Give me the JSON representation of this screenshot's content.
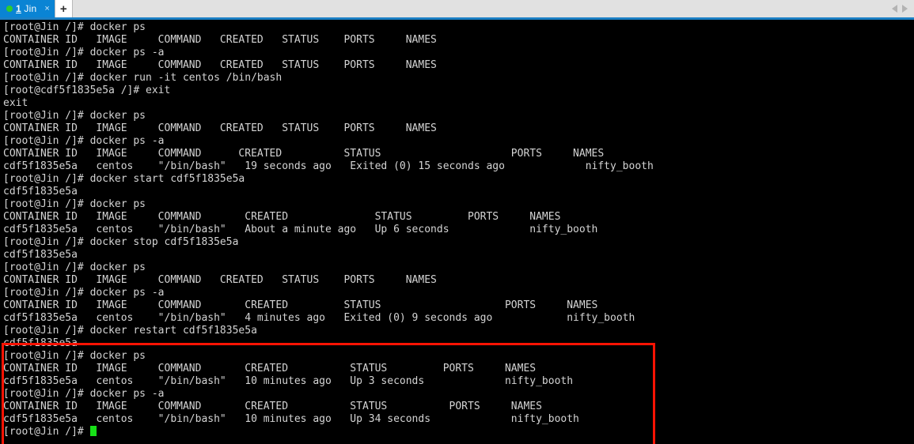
{
  "window": {
    "tab": {
      "status_dot": "green",
      "number": "1",
      "title": "Jin",
      "close_glyph": "×"
    },
    "new_tab_label": "+",
    "nav_prev_icon": "triangle-left-icon",
    "nav_next_icon": "triangle-right-icon",
    "accent_color": "#0a84d4",
    "underline_color": "#1b7fc4",
    "tabbar_bg": "#e1e1e1"
  },
  "terminal": {
    "bg_color": "#000000",
    "fg_color": "#d4d4d4",
    "cursor_color": "#17e017",
    "prompt_host": "[root@Jin /]#",
    "prompt_container": "[root@cdf5f1835e5a /]#",
    "lines": [
      "[root@Jin /]# docker ps",
      "CONTAINER ID   IMAGE     COMMAND   CREATED   STATUS    PORTS     NAMES",
      "[root@Jin /]# docker ps -a",
      "CONTAINER ID   IMAGE     COMMAND   CREATED   STATUS    PORTS     NAMES",
      "[root@Jin /]# docker run -it centos /bin/bash",
      "[root@cdf5f1835e5a /]# exit",
      "exit",
      "[root@Jin /]# docker ps",
      "CONTAINER ID   IMAGE     COMMAND   CREATED   STATUS    PORTS     NAMES",
      "[root@Jin /]# docker ps -a",
      "CONTAINER ID   IMAGE     COMMAND      CREATED          STATUS                     PORTS     NAMES",
      "cdf5f1835e5a   centos    \"/bin/bash\"   19 seconds ago   Exited (0) 15 seconds ago             nifty_booth",
      "[root@Jin /]# docker start cdf5f1835e5a",
      "cdf5f1835e5a",
      "[root@Jin /]# docker ps",
      "CONTAINER ID   IMAGE     COMMAND       CREATED              STATUS         PORTS     NAMES",
      "cdf5f1835e5a   centos    \"/bin/bash\"   About a minute ago   Up 6 seconds             nifty_booth",
      "[root@Jin /]# docker stop cdf5f1835e5a",
      "cdf5f1835e5a",
      "[root@Jin /]# docker ps",
      "CONTAINER ID   IMAGE     COMMAND   CREATED   STATUS    PORTS     NAMES",
      "[root@Jin /]# docker ps -a",
      "CONTAINER ID   IMAGE     COMMAND       CREATED         STATUS                    PORTS     NAMES",
      "cdf5f1835e5a   centos    \"/bin/bash\"   4 minutes ago   Exited (0) 9 seconds ago            nifty_booth",
      "[root@Jin /]# docker restart cdf5f1835e5a",
      "cdf5f1835e5a",
      "[root@Jin /]# docker ps",
      "CONTAINER ID   IMAGE     COMMAND       CREATED          STATUS         PORTS     NAMES",
      "cdf5f1835e5a   centos    \"/bin/bash\"   10 minutes ago   Up 3 seconds             nifty_booth",
      "[root@Jin /]# docker ps -a",
      "CONTAINER ID   IMAGE     COMMAND       CREATED          STATUS          PORTS     NAMES",
      "cdf5f1835e5a   centos    \"/bin/bash\"   10 minutes ago   Up 34 seconds             nifty_booth",
      "[root@Jin /]# "
    ]
  },
  "annotation": {
    "type": "rectangle-highlight",
    "color": "#fc1303",
    "covers_commands": [
      "docker restart cdf5f1835e5a",
      "docker ps",
      "docker ps -a"
    ]
  }
}
